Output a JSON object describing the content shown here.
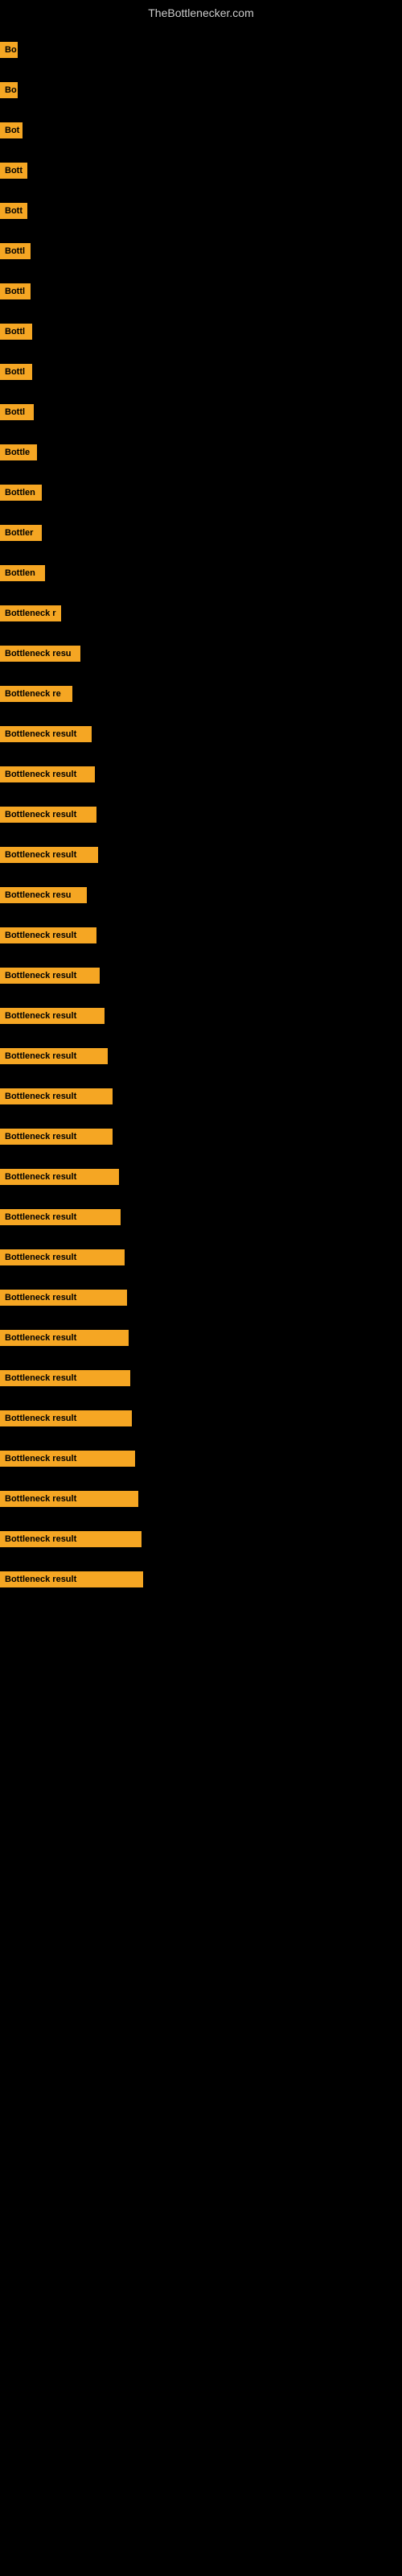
{
  "header": {
    "title": "TheBottlenecker.com"
  },
  "rows": [
    {
      "id": 1,
      "label": "Bo",
      "width": 22
    },
    {
      "id": 2,
      "label": "Bo",
      "width": 22
    },
    {
      "id": 3,
      "label": "Bot",
      "width": 28
    },
    {
      "id": 4,
      "label": "Bott",
      "width": 34
    },
    {
      "id": 5,
      "label": "Bott",
      "width": 34
    },
    {
      "id": 6,
      "label": "Bottl",
      "width": 38
    },
    {
      "id": 7,
      "label": "Bottl",
      "width": 38
    },
    {
      "id": 8,
      "label": "Bottl",
      "width": 40
    },
    {
      "id": 9,
      "label": "Bottl",
      "width": 40
    },
    {
      "id": 10,
      "label": "Bottl",
      "width": 42
    },
    {
      "id": 11,
      "label": "Bottle",
      "width": 46
    },
    {
      "id": 12,
      "label": "Bottlen",
      "width": 52
    },
    {
      "id": 13,
      "label": "Bottler",
      "width": 52
    },
    {
      "id": 14,
      "label": "Bottlen",
      "width": 56
    },
    {
      "id": 15,
      "label": "Bottleneck r",
      "width": 76
    },
    {
      "id": 16,
      "label": "Bottleneck resu",
      "width": 100
    },
    {
      "id": 17,
      "label": "Bottleneck re",
      "width": 90
    },
    {
      "id": 18,
      "label": "Bottleneck result",
      "width": 114
    },
    {
      "id": 19,
      "label": "Bottleneck result",
      "width": 118
    },
    {
      "id": 20,
      "label": "Bottleneck result",
      "width": 120
    },
    {
      "id": 21,
      "label": "Bottleneck result",
      "width": 122
    },
    {
      "id": 22,
      "label": "Bottleneck resu",
      "width": 108
    },
    {
      "id": 23,
      "label": "Bottleneck result",
      "width": 120
    },
    {
      "id": 24,
      "label": "Bottleneck result",
      "width": 124
    },
    {
      "id": 25,
      "label": "Bottleneck result",
      "width": 130
    },
    {
      "id": 26,
      "label": "Bottleneck result",
      "width": 134
    },
    {
      "id": 27,
      "label": "Bottleneck result",
      "width": 140
    },
    {
      "id": 28,
      "label": "Bottleneck result",
      "width": 140
    },
    {
      "id": 29,
      "label": "Bottleneck result",
      "width": 148
    },
    {
      "id": 30,
      "label": "Bottleneck result",
      "width": 150
    },
    {
      "id": 31,
      "label": "Bottleneck result",
      "width": 155
    },
    {
      "id": 32,
      "label": "Bottleneck result",
      "width": 158
    },
    {
      "id": 33,
      "label": "Bottleneck result",
      "width": 160
    },
    {
      "id": 34,
      "label": "Bottleneck result",
      "width": 162
    },
    {
      "id": 35,
      "label": "Bottleneck result",
      "width": 164
    },
    {
      "id": 36,
      "label": "Bottleneck result",
      "width": 168
    },
    {
      "id": 37,
      "label": "Bottleneck result",
      "width": 172
    },
    {
      "id": 38,
      "label": "Bottleneck result",
      "width": 176
    },
    {
      "id": 39,
      "label": "Bottleneck result",
      "width": 178
    }
  ]
}
